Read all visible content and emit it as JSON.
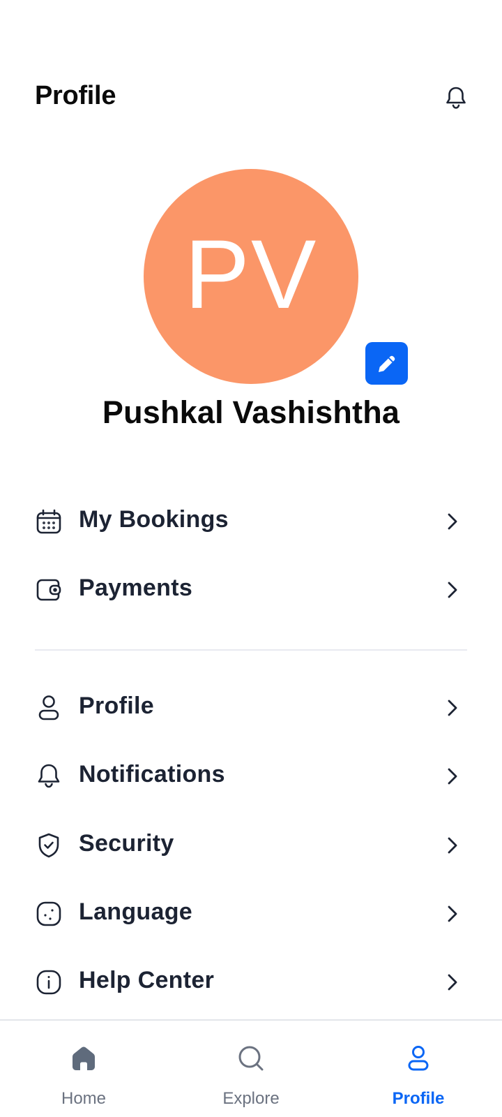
{
  "header": {
    "title": "Profile",
    "bell_icon": "bell-icon"
  },
  "profile": {
    "initials": "PV",
    "name": "Pushkal Vashishtha",
    "avatar_color": "#fb9668",
    "edit_icon": "pencil-icon"
  },
  "menu": {
    "group1": [
      {
        "label": "My Bookings",
        "icon": "calendar-icon"
      },
      {
        "label": "Payments",
        "icon": "wallet-icon"
      }
    ],
    "group2": [
      {
        "label": "Profile",
        "icon": "user-icon"
      },
      {
        "label": "Notifications",
        "icon": "bell-icon"
      },
      {
        "label": "Security",
        "icon": "shield-check-icon"
      },
      {
        "label": "Language",
        "icon": "globe-icon"
      },
      {
        "label": "Help Center",
        "icon": "info-icon"
      }
    ]
  },
  "bottom_nav": {
    "items": [
      {
        "label": "Home",
        "icon": "home-icon",
        "active": false
      },
      {
        "label": "Explore",
        "icon": "search-icon",
        "active": false
      },
      {
        "label": "Profile",
        "icon": "user-icon",
        "active": true
      }
    ]
  },
  "colors": {
    "accent": "#0a66f5",
    "avatar": "#fb9668",
    "text": "#1c2333",
    "muted": "#6b7280"
  }
}
